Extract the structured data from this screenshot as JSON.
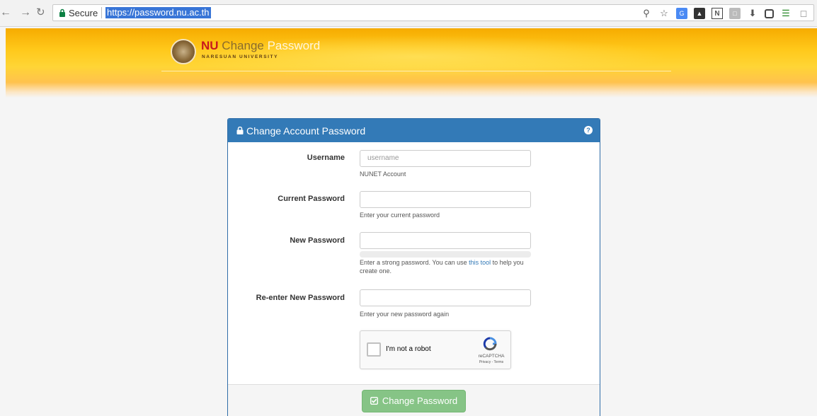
{
  "browser": {
    "secure_label": "Secure",
    "url": "https://password.nu.ac.th"
  },
  "header": {
    "logo_nu": "NU",
    "logo_change": "Change",
    "logo_password": "Password",
    "logo_university": "NARESUAN UNIVERSITY"
  },
  "panel": {
    "title": "Change Account Password",
    "help_symbol": "?"
  },
  "form": {
    "username": {
      "label": "Username",
      "placeholder": "username",
      "help": "NUNET Account"
    },
    "current_password": {
      "label": "Current Password",
      "value": "",
      "help": "Enter your current password"
    },
    "new_password": {
      "label": "New Password",
      "value": "",
      "help_before": "Enter a strong password. You can use ",
      "help_link": "this tool",
      "help_after": " to help you create one.",
      "strength": 0
    },
    "reenter_password": {
      "label": "Re-enter New Password",
      "value": "",
      "help": "Enter your new password again"
    }
  },
  "recaptcha": {
    "label": "I'm not a robot",
    "brand": "reCAPTCHA",
    "terms": "Privacy - Terms"
  },
  "submit": {
    "label": "Change Password"
  },
  "colors": {
    "panel_header": "#337ab7",
    "submit_button": "#86c486",
    "banner": "#ffc81a"
  }
}
